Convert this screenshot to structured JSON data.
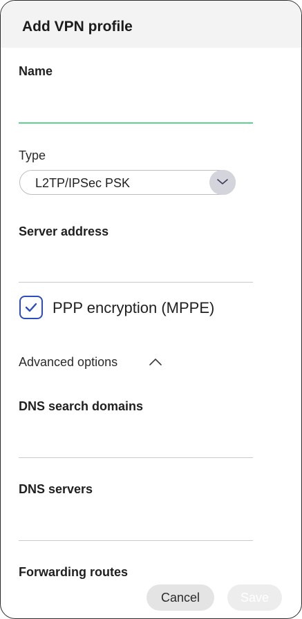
{
  "dialog": {
    "title": "Add VPN profile"
  },
  "fields": {
    "name_label": "Name",
    "name_value": "",
    "type_label": "Type",
    "type_value": "L2TP/IPSec PSK",
    "server_label": "Server address",
    "server_value": "",
    "ppp_label": "PPP encryption (MPPE)",
    "ppp_checked": true,
    "advanced_label": "Advanced options",
    "dns_domains_label": "DNS search domains",
    "dns_domains_value": "",
    "dns_servers_label": "DNS servers",
    "dns_servers_value": "",
    "routes_label": "Forwarding routes"
  },
  "buttons": {
    "cancel": "Cancel",
    "save": "Save"
  },
  "colors": {
    "accent_focus": "#5ed38e",
    "checkbox": "#2b4bbf"
  },
  "icons": {
    "type_dropdown": "chevron-down-icon",
    "advanced_toggle": "chevron-up-icon",
    "checkbox": "checkmark-icon"
  }
}
